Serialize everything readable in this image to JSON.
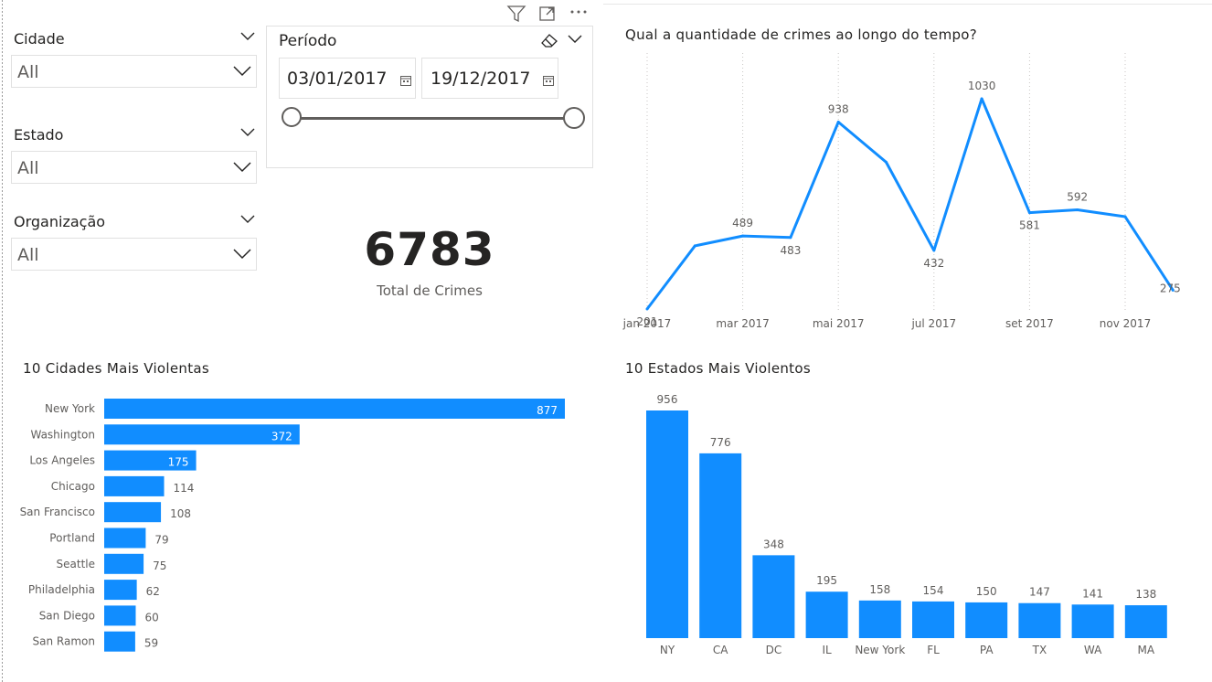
{
  "header_icons": [
    "filter-icon",
    "focus-mode-icon",
    "more-options-icon"
  ],
  "slicers": [
    {
      "title": "Cidade",
      "value": "All"
    },
    {
      "title": "Estado",
      "value": "All"
    },
    {
      "title": "Organização",
      "value": "All"
    }
  ],
  "period": {
    "title": "Período",
    "start": "03/01/2017",
    "end": "19/12/2017",
    "range_fraction": [
      0,
      1
    ]
  },
  "kpi": {
    "value": "6783",
    "label": "Total de Crimes"
  },
  "colors": {
    "accent": "#118DFF",
    "text": "#252423",
    "muted": "#605e5c"
  },
  "chart_data": [
    {
      "type": "line",
      "title": "Qual a quantidade de crimes ao longo do tempo?",
      "x_ticks": [
        "jan 2017",
        "mar 2017",
        "mai 2017",
        "jul 2017",
        "set 2017",
        "nov 2017"
      ],
      "x": [
        "jan 2017",
        "fev 2017",
        "mar 2017",
        "abr 2017",
        "mai 2017",
        "jun 2017",
        "jul 2017",
        "ago 2017",
        "set 2017",
        "out 2017",
        "nov 2017",
        "dez 2017"
      ],
      "values": [
        201,
        450,
        489,
        483,
        938,
        780,
        432,
        1030,
        581,
        592,
        565,
        275
      ],
      "labeled": [
        true,
        false,
        true,
        true,
        true,
        false,
        true,
        true,
        true,
        true,
        false,
        true
      ],
      "ylim": [
        201,
        1030
      ],
      "grid": "vertical dotted"
    },
    {
      "type": "bar",
      "orientation": "horizontal",
      "title": "10 Cidades Mais Violentas",
      "categories": [
        "New York",
        "Washington",
        "Los Angeles",
        "Chicago",
        "San Francisco",
        "Portland",
        "Seattle",
        "Philadelphia",
        "San Diego",
        "San Ramon"
      ],
      "values": [
        877,
        372,
        175,
        114,
        108,
        79,
        75,
        62,
        60,
        59
      ],
      "xlim": [
        0,
        877
      ]
    },
    {
      "type": "bar",
      "orientation": "vertical",
      "title": "10 Estados Mais Violentos",
      "categories": [
        "NY",
        "CA",
        "DC",
        "IL",
        "New York",
        "FL",
        "PA",
        "TX",
        "WA",
        "MA"
      ],
      "values": [
        956,
        776,
        348,
        195,
        158,
        154,
        150,
        147,
        141,
        138
      ],
      "ylim": [
        0,
        956
      ]
    }
  ]
}
